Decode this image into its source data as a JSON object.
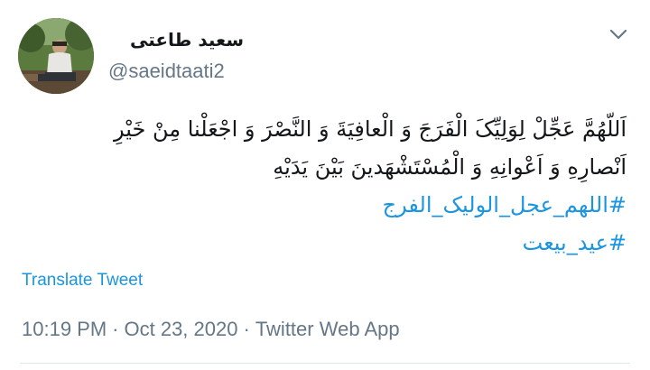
{
  "user": {
    "display_name": "سعید طاعتی",
    "handle": "@saeidtaati2"
  },
  "tweet": {
    "lines": [
      "اَللّهُمَّ عَجِّلْ لِوَلِیِّکَ الْفَرَجَ وَ الْعافِیَةَ وَ النَّصْرَ وَ اجْعَلْنا مِنْ خَیْرِ",
      "اَنْصارِهِ وَ اَعْوانِهِ وَ الْمُسْتَشْهَدینَ بَیْنَ یَدَیْهِ"
    ],
    "hashtags": [
      "#اللهم_عجل_الولیک_الفرج",
      "#عید_بیعت"
    ]
  },
  "translate_label": "Translate Tweet",
  "meta": {
    "time": "10:19 PM",
    "separator": "·",
    "date": "Oct 23, 2020",
    "source": "Twitter Web App"
  },
  "colors": {
    "link": "#1b95e0",
    "secondary_text": "#657786",
    "primary_text": "#14171a",
    "divider": "#e1e8ed"
  },
  "icons": {
    "more": "chevron-down-icon"
  }
}
